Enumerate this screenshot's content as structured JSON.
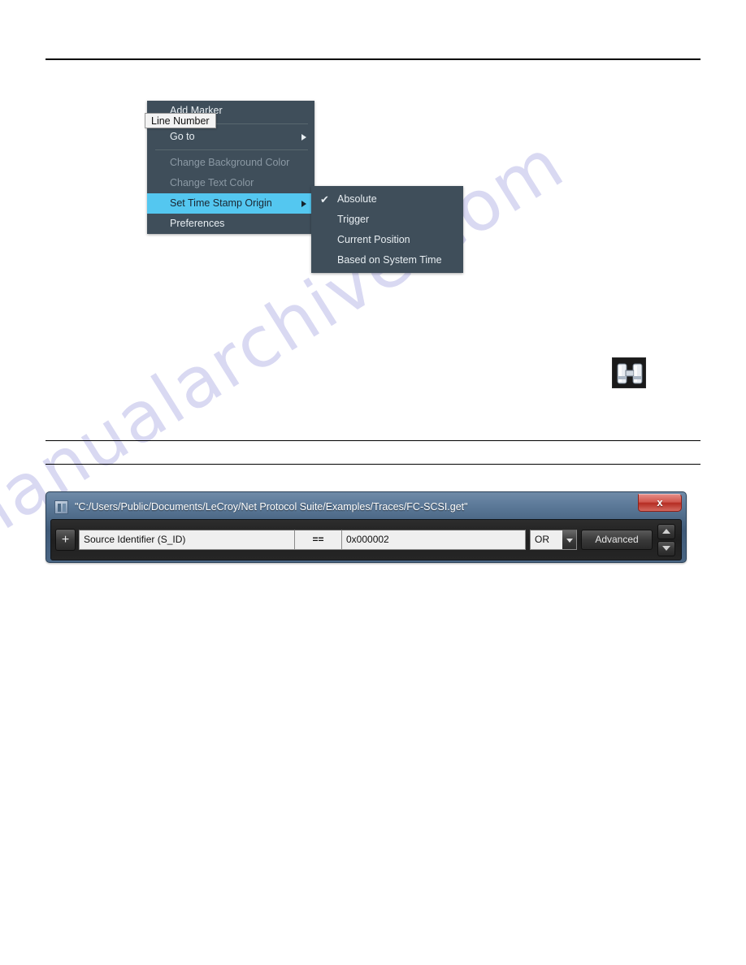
{
  "watermark": {
    "text": "manualarchive.com"
  },
  "context_menu": {
    "items": [
      {
        "label": "Add Marker",
        "state": "normal",
        "submenu": false
      },
      {
        "label": "Go to",
        "state": "normal",
        "submenu": true
      },
      {
        "label": "Change Background Color",
        "state": "disabled",
        "submenu": false
      },
      {
        "label": "Change Text Color",
        "state": "disabled",
        "submenu": false
      },
      {
        "label": "Set Time Stamp Origin",
        "state": "selected",
        "submenu": true
      },
      {
        "label": "Preferences",
        "state": "normal",
        "submenu": false
      }
    ],
    "highlight_color": "#54c7f0",
    "background_color": "#3f4e5a"
  },
  "tooltip": {
    "text": "Line Number"
  },
  "submenu": {
    "title": "Set Time Stamp Origin",
    "checked_index": 0,
    "check_glyph": "✔",
    "items": [
      {
        "label": "Absolute",
        "checked": true
      },
      {
        "label": "Trigger",
        "checked": false
      },
      {
        "label": "Current Position",
        "checked": false
      },
      {
        "label": "Based on System Time",
        "checked": false
      }
    ]
  },
  "binoculars": {
    "icon": "binoculars-icon"
  },
  "filter_dialog": {
    "title": "\"C:/Users/Public/Documents/LeCroy/Net Protocol Suite/Examples/Traces/FC-SCSI.get\"",
    "app_icon": "application-icon",
    "close_label": "x",
    "add_button_label": "+",
    "row": {
      "field_name": "Source Identifier (S_ID)",
      "operator": "==",
      "value": "0x000002",
      "logic_operator": "OR",
      "advanced_label": "Advanced"
    },
    "spinner": {
      "up": "▲",
      "down": "▼"
    },
    "accent_close_color": "#b52d23"
  }
}
